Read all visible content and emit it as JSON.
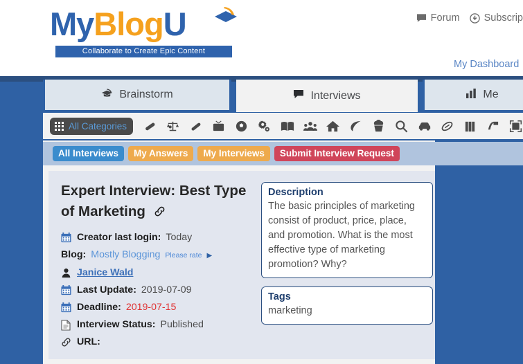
{
  "header": {
    "logo": {
      "part1": "My",
      "part2": "Blog",
      "part3": "U",
      "tagline": "Collaborate to Create Epic Content"
    },
    "top_links": [
      {
        "label": "Forum",
        "icon": "comment-icon"
      },
      {
        "label": "Subscrip",
        "icon": "download-circle-icon"
      }
    ],
    "dashboard_link": "My Dashboard"
  },
  "tabs": [
    {
      "label": "Brainstorm",
      "icon": "graduation-cap-icon",
      "active": false
    },
    {
      "label": "Interviews",
      "icon": "comment-icon",
      "active": true
    },
    {
      "label": "Me",
      "icon": "bar-chart-icon",
      "active": false
    }
  ],
  "toolbar": {
    "all_categories_label": "All Categories",
    "icons": [
      "bandage-icon",
      "balance-scale-icon",
      "pencil-eraser-icon",
      "television-icon",
      "soccer-ball-icon",
      "gears-icon",
      "book-icon",
      "users-icon",
      "home-icon",
      "leaf-icon",
      "cupcake-icon",
      "search-icon",
      "car-icon",
      "football-icon",
      "briefcase-icon",
      "golf-flag-icon",
      "fullscreen-icon"
    ]
  },
  "filters": [
    {
      "label": "All Interviews",
      "color": "#3a8ccd",
      "active": true
    },
    {
      "label": "My Answers",
      "color": "#eeaa4d",
      "active": false
    },
    {
      "label": "My Interviews",
      "color": "#eeaa4d",
      "active": false
    },
    {
      "label": "Submit Interview Request",
      "color": "#d0455a",
      "active": false
    }
  ],
  "interview": {
    "title": "Expert Interview: Best Type of Marketing",
    "creator_last_login_label": "Creator last login:",
    "creator_last_login_value": "Today",
    "blog_label": "Blog:",
    "blog_name": "Mostly Blogging",
    "please_rate": "Please rate",
    "rate_caret": "▶",
    "author": "Janice Wald",
    "last_update_label": "Last Update:",
    "last_update_value": "2019-07-09",
    "deadline_label": "Deadline:",
    "deadline_value": "2019-07-15",
    "status_label": "Interview Status:",
    "status_value": "Published",
    "url_label": "URL:",
    "url_value": "",
    "description_title": "Description",
    "description_body": "The basic principles of marketing consist of product, price, place, and promotion. What is the most effective type of marketing promotion? Why?",
    "tags_title": "Tags",
    "tags_body": "marketing"
  },
  "colors": {
    "page_background": "#2f61a4",
    "brand_blue": "#2f63ad",
    "brand_orange": "#f5a11e",
    "card_background": "#e2e6ef",
    "deadline_red": "#e03030"
  }
}
